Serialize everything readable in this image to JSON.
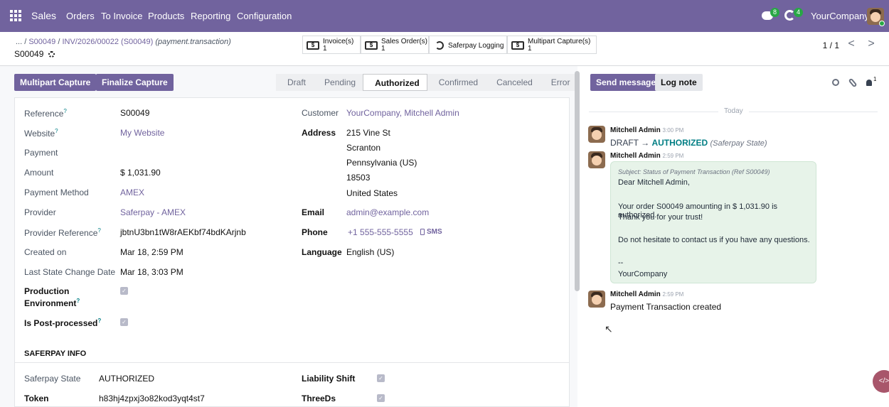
{
  "topbar": {
    "app": "Sales",
    "menu": [
      "Orders",
      "To Invoice",
      "Products",
      "Reporting",
      "Configuration"
    ],
    "msg_count": "8",
    "act_count": "4",
    "company": "YourCompany",
    "colors": {
      "navbar": "#71639e",
      "primary": "#71639e",
      "link": "#71639e"
    }
  },
  "breadcrumb": {
    "prefix": "... /",
    "p1": "S00049",
    "sep": "/",
    "p2": "INV/2026/00022 (S00049)",
    "model": "(payment.transaction)",
    "record": "S00049"
  },
  "smart": [
    {
      "l1": "Invoice(s)",
      "l2": "1"
    },
    {
      "l1": "Sales Order(s)",
      "l2": "1"
    },
    {
      "l1": "Saferpay Logging",
      "l2": ""
    },
    {
      "l1": "Multipart Capture(s)",
      "l2": "1"
    }
  ],
  "pager": {
    "text": "1 / 1",
    "prev": "<",
    "next": ">"
  },
  "actions": {
    "multipart": "Multipart Capture",
    "finalize": "Finalize Capture"
  },
  "statusbar": [
    "Draft",
    "Pending",
    "Authorized",
    "Confirmed",
    "Canceled",
    "Error"
  ],
  "fields": {
    "reference": {
      "label": "Reference",
      "value": "S00049"
    },
    "website": {
      "label": "Website",
      "value": "My Website"
    },
    "payment": {
      "label": "Payment"
    },
    "amount": {
      "label": "Amount",
      "value": "$ 1,031.90"
    },
    "method": {
      "label": "Payment Method",
      "value": "AMEX"
    },
    "provider": {
      "label": "Provider",
      "value": "Saferpay - AMEX"
    },
    "provref": {
      "label": "Provider Reference",
      "value": "jbtnU3bn1tW8rAEKbf74bdKArjnb"
    },
    "created": {
      "label": "Created on",
      "value": "Mar 18, 2:59 PM"
    },
    "lastchange": {
      "label": "Last State Change Date",
      "value": "Mar 18, 3:03 PM"
    },
    "prod1": "Production",
    "prod2": "Environment",
    "postproc": "Is Post-processed",
    "customer": {
      "label": "Customer",
      "value": "YourCompany, Mitchell Admin"
    },
    "address": {
      "label": "Address",
      "lines": [
        "215 Vine St",
        "Scranton",
        "Pennsylvania (US)",
        "18503",
        "United States"
      ]
    },
    "email": {
      "label": "Email",
      "value": "admin@example.com"
    },
    "phone": {
      "label": "Phone",
      "value": "+1 555-555-5555",
      "sms": "SMS"
    },
    "language": {
      "label": "Language",
      "value": "English (US)"
    }
  },
  "saferpay": {
    "title": "SAFERPAY INFO",
    "state_label": "Saferpay State",
    "state": "AUTHORIZED",
    "token_label": "Token",
    "token": "h83hj4zpxj3o82kod3yqt4st7",
    "liability": "Liability Shift",
    "threeds": "ThreeDs"
  },
  "chatter": {
    "send": "Send message",
    "log": "Log note",
    "followers": "1",
    "today": "Today",
    "m1": {
      "author": "Mitchell Admin",
      "time": "3:00 PM",
      "from": "DRAFT",
      "arrow": "→",
      "to": "AUTHORIZED",
      "field": "(Saferpay State)"
    },
    "m2": {
      "author": "Mitchell Admin",
      "time": "2:59 PM",
      "subject": "Subject: Status of Payment Transaction (Ref S00049)",
      "l1": "Dear Mitchell Admin,",
      "l2": "Your order S00049 amounting in $ 1,031.90 is authorized.",
      "l3": "Thank you for your trust!",
      "l4": "Do not hesitate to contact us if you have any questions.",
      "l5": "--",
      "l6": "YourCompany"
    },
    "m3": {
      "author": "Mitchell Admin",
      "time": "2:59 PM",
      "text": "Payment Transaction created"
    }
  },
  "icons": [
    "apps-grid-icon",
    "messages-icon",
    "activity-icon",
    "gear-icon",
    "invoice-icon",
    "history-icon",
    "search-icon",
    "paperclip-icon",
    "followers-icon",
    "mobile-icon",
    "checkbox-icon",
    "cursor-icon",
    "code-icon"
  ]
}
